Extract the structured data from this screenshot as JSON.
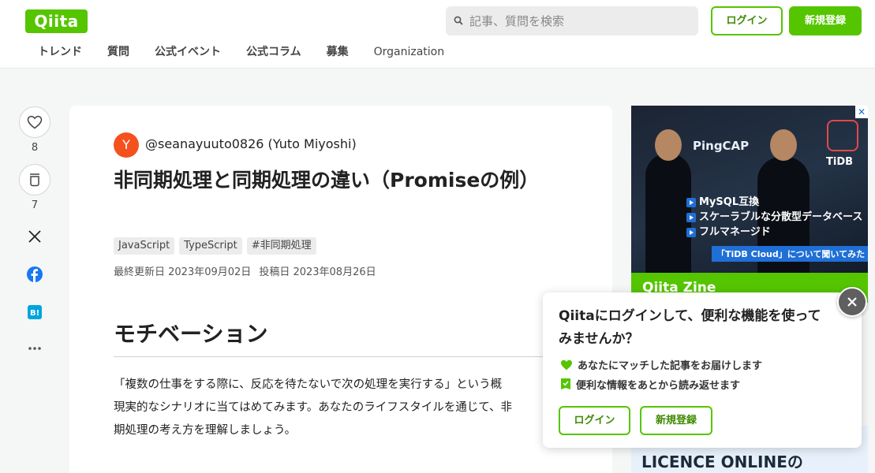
{
  "header": {
    "logo": "Qiita",
    "search_placeholder": "記事、質問を検索",
    "login_label": "ログイン",
    "signup_label": "新規登録",
    "nav": [
      "トレンド",
      "質問",
      "公式イベント",
      "公式コラム",
      "募集",
      "Organization"
    ]
  },
  "rail": {
    "likes": "8",
    "stocks": "7",
    "icons": [
      "heart-icon",
      "stock-icon",
      "x-icon",
      "facebook-icon",
      "hatena-bookmark-icon",
      "more-icon"
    ]
  },
  "article": {
    "author_initial": "Y",
    "author": "@seanayuuto0826 (Yuto Miyoshi)",
    "title": "非同期処理と同期処理の違い（Promiseの例）",
    "tags": [
      "JavaScript",
      "TypeScript",
      "#非同期処理"
    ],
    "updated": "最終更新日 2023年09月02日",
    "posted": "投稿日 2023年08月26日",
    "heading": "モチベーション",
    "paragraph": [
      "「複数の仕事をする際に、反応を待たないで次の処理を実行する」という概",
      "現実的なシナリオに当てはめてみます。あなたのライフスタイルを通じて、非",
      "期処理の考え方を理解しましょう。"
    ]
  },
  "ad": {
    "brand": "PingCAP",
    "product": "TiDB",
    "features": [
      "MySQL互換",
      "スケーラブルな分散型データベース",
      "フルマネージド"
    ],
    "cta": "「TiDB Cloud」について聞いてみた",
    "footer": "Qiita Zine",
    "second_text": "LICENCE ONLINEの"
  },
  "popup": {
    "title": "Qiitaにログインして、便利な機能を使ってみませんか？",
    "features": [
      "あなたにマッチした記事をお届けします",
      "便利な情報をあとから読み返せます"
    ],
    "login_label": "ログイン",
    "signup_label": "新規登録"
  },
  "colors": {
    "brand": "#55c500",
    "brand_dark": "#3e8b00",
    "avatar": "#f4511e"
  }
}
